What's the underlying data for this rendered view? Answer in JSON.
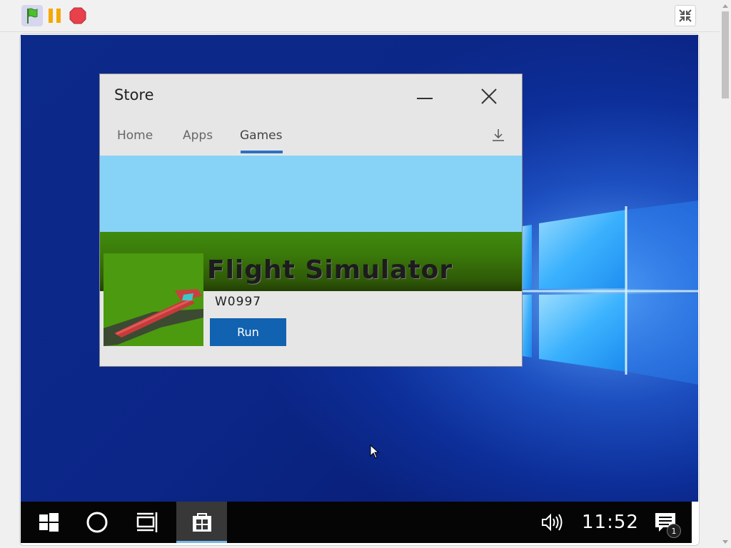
{
  "toolbar": {
    "flag_icon": "green-flag-icon",
    "pause_icon": "pause-icon",
    "stop_icon": "stop-icon",
    "shrink_icon": "shrink-stage-icon"
  },
  "store_window": {
    "title": "Store",
    "tabs": [
      {
        "label": "Home"
      },
      {
        "label": "Apps"
      },
      {
        "label": "Games",
        "active": true
      }
    ],
    "game": {
      "title": "Flight Simulator",
      "id": "W0997",
      "run_label": "Run"
    }
  },
  "taskbar": {
    "clock": "11:52",
    "notification_count": "1"
  },
  "colors": {
    "accent": "#1162b0",
    "tab_underline": "#2b72c2",
    "sky": "#87d3f8",
    "grass": "#3f8c0e",
    "taskbar": "#050505",
    "desktop": "#0c2a8a"
  }
}
